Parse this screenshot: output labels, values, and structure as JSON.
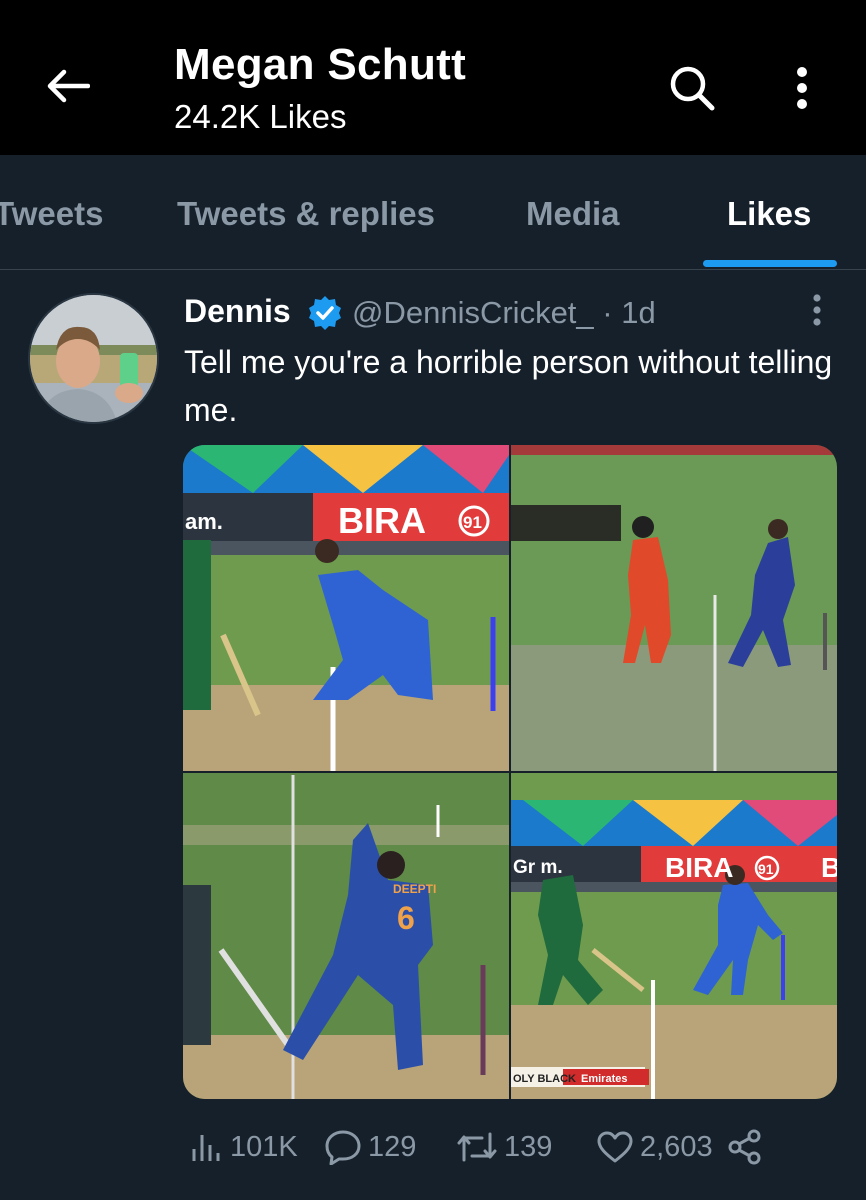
{
  "header": {
    "title": "Megan Schutt",
    "subtitle": "24.2K Likes",
    "icons": {
      "back": "back-arrow-icon",
      "search": "search-icon",
      "more": "more-vertical-icon"
    }
  },
  "tabs": [
    {
      "label": "Tweets",
      "active": false
    },
    {
      "label": "Tweets & replies",
      "active": false
    },
    {
      "label": "Media",
      "active": false
    },
    {
      "label": "Likes",
      "active": true
    }
  ],
  "tweet": {
    "author_name": "Dennis",
    "handle_and_time": "@DennisCricket_ · 1d",
    "text": "Tell me you're a horrible person without telling me.",
    "media_labels": {
      "board_1": "BIRA",
      "board_1_num": "91",
      "board_1_left": "am.",
      "board_4": "BIRA",
      "board_4_num": "91",
      "board_4_left": "Gr m.",
      "board_4_right": "B",
      "jersey_name": "DEEPTI",
      "jersey_number": "6",
      "footer_left": "OLY BLACK",
      "footer_right": "Emirates"
    },
    "stats": {
      "views": "101K",
      "replies": "129",
      "retweets": "139",
      "likes": "2,603"
    }
  },
  "colors": {
    "background": "#15202b",
    "header_bg": "#000000",
    "accent": "#1d9bf0",
    "muted_text": "#8b98a5",
    "text": "#ffffff"
  }
}
